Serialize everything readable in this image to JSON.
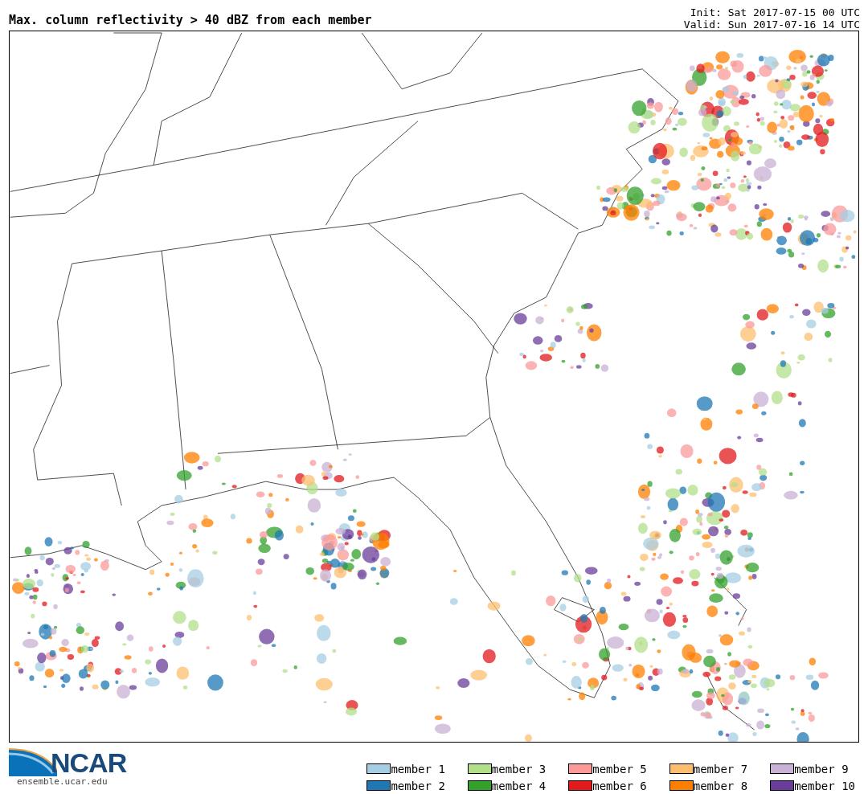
{
  "title": "Max. column reflectivity > 40 dBZ from each member",
  "init": "Init: Sat 2017-07-15 00 UTC",
  "valid": "Valid: Sun 2017-07-16 14 UTC",
  "logo": {
    "name": "NCAR",
    "url": "ensemble.ucar.edu"
  },
  "legend": [
    {
      "label": "member 1",
      "color": "#a6cee3"
    },
    {
      "label": "member 2",
      "color": "#1f78b4"
    },
    {
      "label": "member 3",
      "color": "#b2df8a"
    },
    {
      "label": "member 4",
      "color": "#33a02c"
    },
    {
      "label": "member 5",
      "color": "#fb9a99"
    },
    {
      "label": "member 6",
      "color": "#e31a1c"
    },
    {
      "label": "member 7",
      "color": "#fdbf6f"
    },
    {
      "label": "member 8",
      "color": "#ff7f00"
    },
    {
      "label": "member 9",
      "color": "#cab2d6"
    },
    {
      "label": "member 10",
      "color": "#6a3d9a"
    }
  ]
}
